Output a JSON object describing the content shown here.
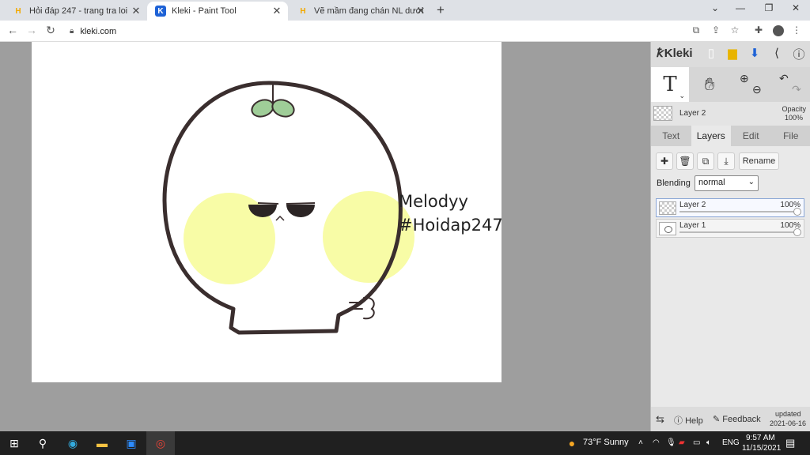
{
  "browser": {
    "tabs": [
      {
        "title": "Hỏi đáp 247 - trang tra loi",
        "favicon": "H"
      },
      {
        "title": "Kleki - Paint Tool",
        "favicon": "K"
      },
      {
        "title": "Vẽ mầm đang chán NL dưới bl c",
        "favicon": "H"
      }
    ],
    "new_tab": "+",
    "url": "kleki.com"
  },
  "canvas": {
    "signature_line1": "Melodyy",
    "signature_line2": "#Hoidap247"
  },
  "kleki": {
    "logo": "Kleki",
    "tool_text": "T",
    "layer_header": {
      "name": "Layer 2",
      "opacity_label": "Opacity",
      "opacity_value": "100%"
    },
    "tabs": [
      "Text",
      "Layers",
      "Edit",
      "File"
    ],
    "rename_label": "Rename",
    "blending_label": "Blending",
    "blending_value": "normal",
    "layers": [
      {
        "name": "Layer 2",
        "opacity": "100%",
        "active": true
      },
      {
        "name": "Layer 1",
        "opacity": "100%",
        "active": false
      }
    ],
    "footer": {
      "help": "Help",
      "feedback": "Feedback",
      "updated_label": "updated",
      "updated_date": "2021-06-16"
    }
  },
  "taskbar": {
    "weather": "73°F  Sunny",
    "language": "ENG",
    "time": "9:57 AM",
    "date": "11/15/2021"
  },
  "colors": {
    "cheek": "#f8fca6",
    "leaf": "#9fcd98",
    "outline": "#3a2e2e",
    "tab_active": "#ffffff"
  }
}
